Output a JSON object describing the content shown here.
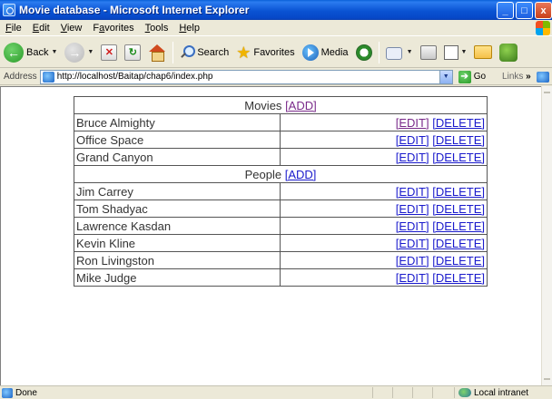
{
  "window": {
    "title": "Movie database - Microsoft Internet Explorer",
    "buttons": {
      "minimize": "_",
      "maximize": "□",
      "close": "x"
    }
  },
  "menu": [
    {
      "pre": "",
      "u": "F",
      "post": "ile"
    },
    {
      "pre": "",
      "u": "E",
      "post": "dit"
    },
    {
      "pre": "",
      "u": "V",
      "post": "iew"
    },
    {
      "pre": "F",
      "u": "a",
      "post": "vorites"
    },
    {
      "pre": "",
      "u": "T",
      "post": "ools"
    },
    {
      "pre": "",
      "u": "H",
      "post": "elp"
    }
  ],
  "toolbar": {
    "back_label": "Back",
    "search_label": "Search",
    "favorites_label": "Favorites",
    "media_label": "Media"
  },
  "address": {
    "label": "Address",
    "url": "http://localhost/Baitap/chap6/index.php",
    "go_label": "Go",
    "links_label": "Links"
  },
  "page": {
    "movies_header": "Movies",
    "people_header": "People",
    "add_label": "[ADD]",
    "edit_label": "[EDIT]",
    "delete_label": "[DELETE]",
    "movies": [
      "Bruce Almighty",
      "Office Space",
      "Grand Canyon"
    ],
    "people": [
      "Jim Carrey",
      "Tom Shadyac",
      "Lawrence Kasdan",
      "Kevin Kline",
      "Ron Livingston",
      "Mike Judge"
    ]
  },
  "status": {
    "text": "Done",
    "zone": "Local intranet"
  }
}
